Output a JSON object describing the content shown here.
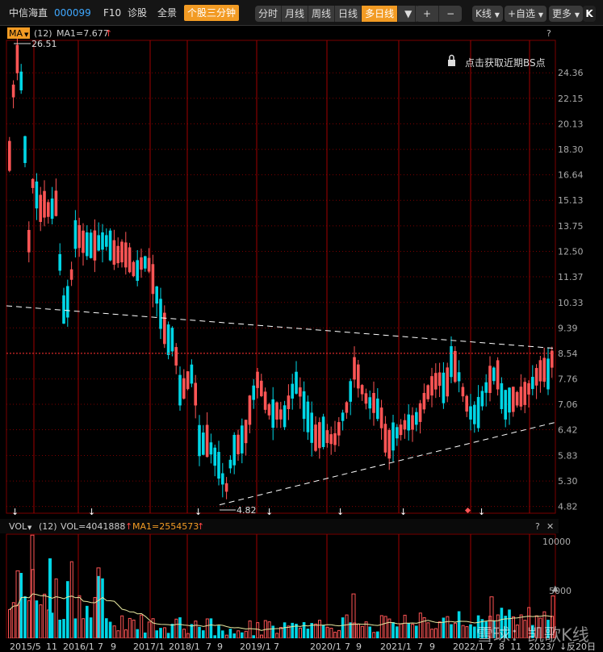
{
  "toolbar": {
    "stock_name": "中信海直",
    "stock_code": "000099",
    "f10": "F10",
    "diagnose": "诊股",
    "panorama": "全景",
    "three_min": "个股三分钟",
    "periods": [
      "分时",
      "月线",
      "周线",
      "日线",
      "多日线"
    ],
    "plus": "+",
    "minus": "−",
    "kline": "K线",
    "add_watch": "+自选",
    "more": "更多",
    "logo": "K"
  },
  "main_panel": {
    "indicator": "MA",
    "param": "(12)",
    "ma_label": "MA1=7.677",
    "help": "?",
    "bs_hint": "点击获取近期BS点",
    "high_label": "26.51",
    "low_label": "4.82",
    "price_ticks": [
      "24.36",
      "22.15",
      "20.13",
      "18.30",
      "16.64",
      "15.13",
      "13.75",
      "12.50",
      "11.37",
      "10.33",
      "9.39",
      "8.54",
      "7.76",
      "7.06",
      "6.42",
      "5.83",
      "5.30",
      "4.82"
    ]
  },
  "vol_panel": {
    "indicator": "VOL",
    "param": "(12)",
    "vol_label": "VOL=4041888",
    "ma_label": "MA1=2554573",
    "help": "?",
    "close": "✕",
    "ticks": [
      "10000",
      "5000"
    ]
  },
  "x_axis": {
    "labels": [
      "2015/5",
      "11",
      "2016/1",
      "7",
      "9",
      "2017/1",
      "2018/1",
      "7",
      "9",
      "2019/1",
      "7",
      "2020/1",
      "7",
      "9",
      "2021/1",
      "7",
      "9",
      "2022/1",
      "7",
      "8",
      "11",
      "2023/"
    ],
    "back_label": "反20日"
  },
  "watermark": "雪球：凯歌K线",
  "colors": {
    "up": "#ff5555",
    "down": "#00d6e6",
    "grid": "#7a0000",
    "axis_text": "#aaaaaa",
    "ma_line": "#e8e8a0",
    "accent": "#f29b24"
  },
  "chart_data": {
    "type": "candlestick",
    "y_scale": "log",
    "y_range": [
      4.7,
      27.5
    ],
    "x_range_months": [
      "2015/5",
      "2023/"
    ],
    "price_levels": [
      24.36,
      22.15,
      20.13,
      18.3,
      16.64,
      15.13,
      13.75,
      12.5,
      11.37,
      10.33,
      9.39,
      8.54,
      7.76,
      7.06,
      6.42,
      5.83,
      5.3,
      4.82
    ],
    "high": 26.51,
    "low": 4.82,
    "current_ma": 7.677,
    "volume_ticks": [
      10000,
      5000
    ]
  }
}
